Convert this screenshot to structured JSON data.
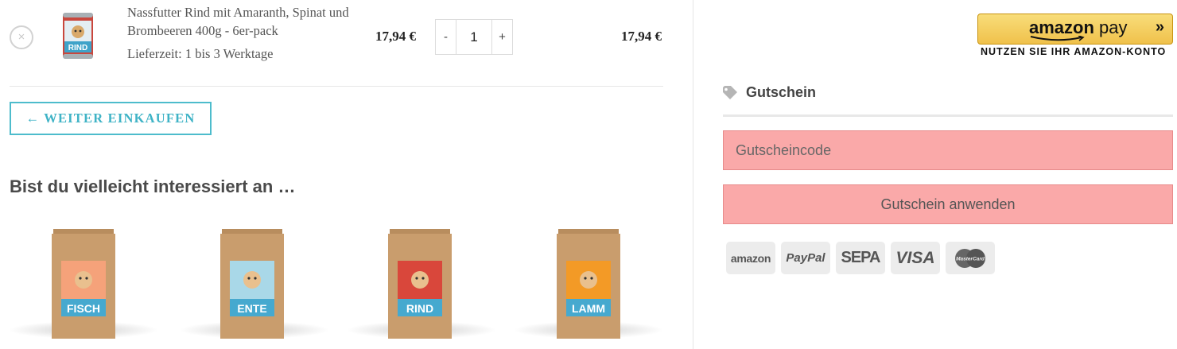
{
  "cart_item": {
    "remove_icon": "×",
    "name": "Nassfutter Rind mit Amaranth, Spinat und Brombeeren 400g - 6er-pack",
    "delivery": "Lieferzeit: 1 bis 3 Werktage",
    "unit_price": "17,94 €",
    "quantity": {
      "decrement": "-",
      "value": "1",
      "increment": "+"
    },
    "total_price": "17,94 €",
    "can_label": "RIND"
  },
  "continue_shopping": "← WEITER EINKAUFEN",
  "upsell": {
    "title": "Bist du vielleicht interessiert an …",
    "products": [
      {
        "label": "FISCH",
        "panel_color": "#f5a27a"
      },
      {
        "label": "ENTE",
        "panel_color": "#a9d8e8"
      },
      {
        "label": "RIND",
        "panel_color": "#d9473b"
      },
      {
        "label": "LAMM",
        "panel_color": "#f39a26"
      }
    ]
  },
  "amazon_pay": {
    "brand": "amazon",
    "pay": "pay",
    "arrows": "»",
    "subtext": "NUTZEN SIE IHR AMAZON-KONTO"
  },
  "coupon": {
    "heading": "Gutschein",
    "placeholder": "Gutscheincode",
    "apply_label": "Gutschein anwenden"
  },
  "payment_methods": [
    "amazon",
    "PayPal",
    "SEPA",
    "VISA",
    "MasterCard"
  ],
  "colors": {
    "accent": "#3fb3c6",
    "coupon_highlight": "#faa9a9",
    "amazon_gold": "#f0c14b"
  }
}
